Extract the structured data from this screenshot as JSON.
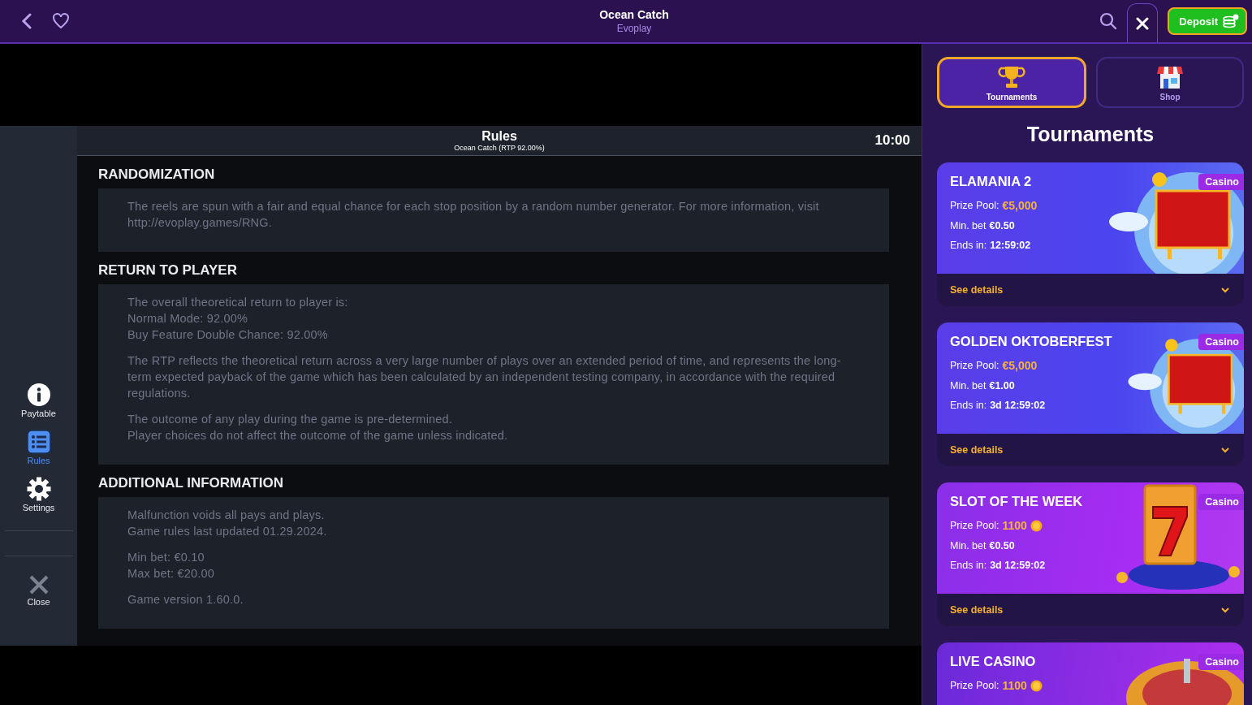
{
  "header": {
    "title": "Ocean Catch",
    "subtitle": "Evoplay",
    "deposit": "Deposit"
  },
  "game_menu": [
    {
      "kind": "info",
      "label": "Paytable",
      "selected": false
    },
    {
      "kind": "list",
      "label": "Rules",
      "selected": true
    },
    {
      "kind": "gear",
      "label": "Settings",
      "selected": false
    },
    {
      "kind": "close",
      "label": "Close",
      "selected": false
    }
  ],
  "rules": {
    "title": "Rules",
    "subtitle": "Ocean Catch (RTP 92.00%)",
    "clock": "10:00",
    "sections": [
      {
        "heading": "RANDOMIZATION",
        "paragraphs": [
          [
            "The reels are spun with a fair and equal chance for each stop position by a random number generator. For more information, visit http://evoplay.games/RNG."
          ]
        ]
      },
      {
        "heading": "RETURN TO PLAYER",
        "paragraphs": [
          [
            "The overall theoretical return to player is:",
            "Normal Mode: 92.00%",
            "Buy Feature Double Chance: 92.00%"
          ],
          [
            "The RTP reflects the theoretical return across a very large number of plays over an extended period of time, and represents the long-term expected payback of the game which has been calculated by an independent testing company, in accordance with the required regulations."
          ],
          [
            "The outcome of any play during the game is pre-determined.",
            "Player choices do not affect the outcome of the game unless indicated."
          ]
        ]
      },
      {
        "heading": "ADDITIONAL INFORMATION",
        "paragraphs": [
          [
            "Malfunction voids all pays and plays.",
            "Game rules last updated 01.29.2024."
          ],
          [
            "Min bet: €0.10",
            "Max bet: €20.00"
          ],
          [
            "Game version 1.60.0."
          ]
        ]
      }
    ]
  },
  "panel_tabs": [
    {
      "kind": "trophy",
      "label": "Tournaments",
      "selected": true
    },
    {
      "kind": "shop",
      "label": "Shop",
      "selected": false
    }
  ],
  "panel_title": "Tournaments",
  "tournaments": [
    {
      "kind": "carpet",
      "title": "ELAMANIA 2",
      "badge": "Casino",
      "prize_label": "Prize Pool:",
      "prize": "€5,000",
      "coin": false,
      "bet_label": "Min. bet",
      "bet": "€0.50",
      "ends_label": "Ends in:",
      "ends": "12:59:02",
      "details": "See details"
    },
    {
      "kind": "carpet",
      "title": "GOLDEN OKTOBERFEST",
      "badge": "Casino",
      "prize_label": "Prize Pool:",
      "prize": "€5,000",
      "coin": false,
      "bet_label": "Min. bet",
      "bet": "€1.00",
      "ends_label": "Ends in:",
      "ends": "3d 12:59:02",
      "details": "See details"
    },
    {
      "kind": "slot",
      "title": "SLOT OF THE WEEK",
      "badge": "Casino",
      "prize_label": "Prize Pool:",
      "prize": "1100",
      "coin": true,
      "bet_label": "Min. bet",
      "bet": "€0.50",
      "ends_label": "Ends in:",
      "ends": "3d 12:59:02",
      "details": "See details"
    },
    {
      "kind": "roulette",
      "title": "LIVE CASINO",
      "badge": "Casino",
      "prize_label": "Prize Pool:",
      "prize": "1100",
      "coin": true
    }
  ]
}
